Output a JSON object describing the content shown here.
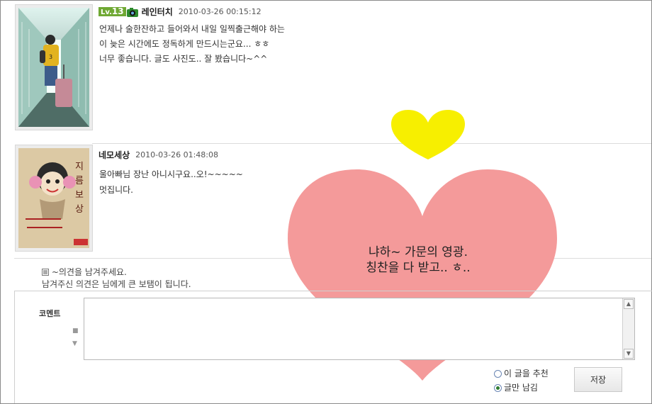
{
  "comments": [
    {
      "level_prefix": "Lv.",
      "level_num": "13",
      "author": "레인터치",
      "date": "2010-03-26 00:15:12",
      "lines": [
        "언제나 술한잔하고 들어와서 내일 일찍출근해야 하는",
        "이 늦은 시간에도 정독하게 만드시는군요... ㅎㅎ",
        "너무 좋습니다. 글도 사진도.. 잘 봤습니다~^^"
      ]
    },
    {
      "author": "네모세상",
      "date": "2010-03-26 01:48:08",
      "lines": [
        "울아빠님 장난 아니시구요..오!~~~~~",
        "멋집니다."
      ],
      "avatar_text": "지름보상"
    }
  ],
  "heart_message": {
    "line1": "냐하~  가문의 영광.",
    "line2": "칭찬을 다 받고.. ㅎ.."
  },
  "guide": {
    "line1": "~의견을 남겨주세요.",
    "line2": "남겨주신 의견은 님에게 큰 보탬이 됩니다."
  },
  "form": {
    "comment_label": "코멘트",
    "radio_recommend": "이 글을 추천",
    "radio_comment_only": "글만 남김",
    "save_label": "저장"
  },
  "colors": {
    "heart_yellow": "#f7ef00",
    "heart_pink": "#f49a9a",
    "level_badge": "#6fa833"
  }
}
